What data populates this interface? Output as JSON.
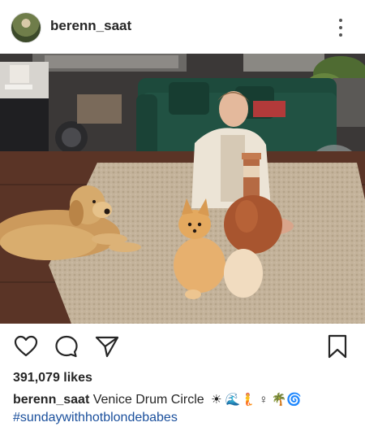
{
  "header": {
    "username": "berenn_saat",
    "more_icon": "more-vertical-icon"
  },
  "post": {
    "image_alt": "Woman seated on a shaggy rug holding a terracotta drum, with a golden retriever and a Pomeranian in a living room",
    "actions": {
      "like_icon": "heart-icon",
      "comment_icon": "comment-icon",
      "share_icon": "send-icon",
      "save_icon": "bookmark-icon"
    },
    "likes": "391,079 likes",
    "caption": {
      "username": "berenn_saat",
      "text": "Venice Drum Circle",
      "emoji": "☀ 🌊🧜 ♀ 🌴🌀",
      "hashtag": "#sundaywithhotblondebabes"
    }
  },
  "colors": {
    "text": "#262626",
    "hashtag": "#1a4f9c",
    "sofa": "#1f4a3c",
    "rug": "#bfae95",
    "floor": "#5a3426"
  }
}
